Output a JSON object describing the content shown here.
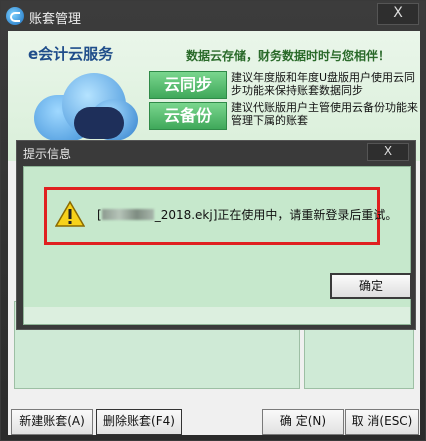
{
  "window": {
    "title": "账套管理",
    "close_label": "X"
  },
  "banner": {
    "brand": "e会计云服务",
    "slogan": "数据云存储，财务数据时时与您相伴！",
    "features": [
      {
        "button": "云同步",
        "text": "建议年度版和年度U盘版用户使用云同步功能来保持账套数据同步"
      },
      {
        "button": "云备份",
        "text": "建议代账版用户主管使用云备份功能来管理下属的账套"
      }
    ]
  },
  "dialog": {
    "title": "提示信息",
    "close_label": "X",
    "message_suffix": "_2018.ekj]正在使用中，请重新登录后重试。",
    "message_prefix": "[",
    "ok_label": "确定"
  },
  "bottom_buttons": {
    "new": "新建账套(A)",
    "delete": "删除账套(F4)",
    "confirm": "确 定(N)",
    "cancel": "取 消(ESC)"
  }
}
